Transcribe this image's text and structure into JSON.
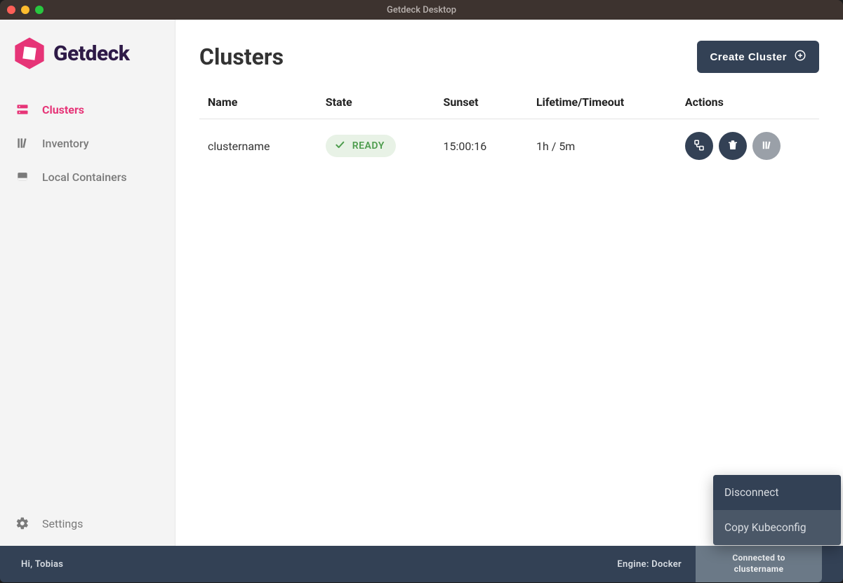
{
  "window": {
    "title": "Getdeck Desktop"
  },
  "brand": {
    "name": "Getdeck"
  },
  "sidebar": {
    "items": [
      {
        "label": "Clusters",
        "icon": "server-icon",
        "active": true
      },
      {
        "label": "Inventory",
        "icon": "library-icon",
        "active": false
      },
      {
        "label": "Local Containers",
        "icon": "container-icon",
        "active": false
      }
    ],
    "settings_label": "Settings"
  },
  "page": {
    "title": "Clusters",
    "create_label": "Create Cluster"
  },
  "table": {
    "columns": [
      "Name",
      "State",
      "Sunset",
      "Lifetime/Timeout",
      "Actions"
    ],
    "rows": [
      {
        "name": "clustername",
        "state": "READY",
        "sunset": "15:00:16",
        "lifetime": "1h / 5m"
      }
    ]
  },
  "actions": {
    "connect": "connect-icon",
    "delete": "trash-icon",
    "shelf": "shelf-icon"
  },
  "popup": {
    "items": [
      {
        "label": "Disconnect"
      },
      {
        "label": "Copy Kubeconfig"
      }
    ]
  },
  "footer": {
    "greeting": "Hi, Tobias",
    "engine": "Engine: Docker",
    "connected_line1": "Connected to",
    "connected_line2": "clustername"
  },
  "colors": {
    "accent": "#e63477",
    "dark": "#334155",
    "ready": "#4e9d4e"
  }
}
